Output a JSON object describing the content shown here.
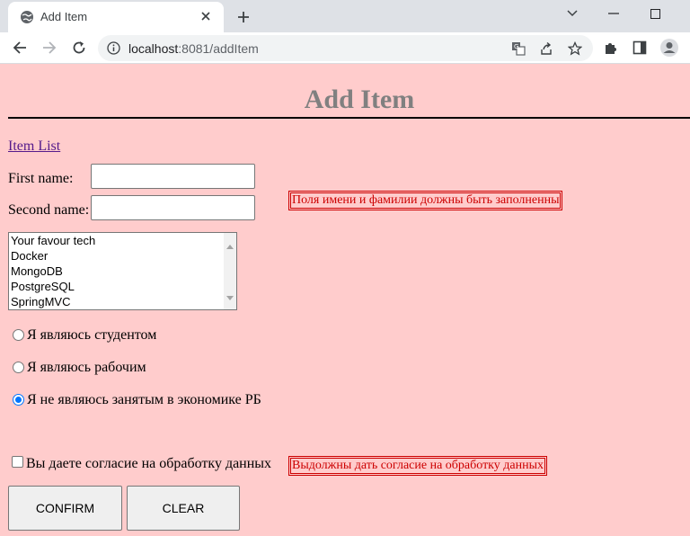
{
  "browser": {
    "tab_title": "Add Item",
    "url_host": "localhost",
    "url_path": ":8081/addItem"
  },
  "page": {
    "title": "Add Item",
    "nav_link": "Item List"
  },
  "form": {
    "first_name_label": "First name:",
    "second_name_label": "Second name:",
    "first_name_value": "",
    "second_name_value": "",
    "name_error": "Поля имени и фамилии должны быть заполненны",
    "tech_options": [
      "Your favour tech",
      "Docker",
      "MongoDB",
      "PostgreSQL",
      "SpringMVC"
    ],
    "employment": [
      {
        "label": "Я являюсь студентом",
        "checked": false
      },
      {
        "label": "Я являюсь рабочим",
        "checked": false
      },
      {
        "label": "Я не являюсь занятым в экономике РБ",
        "checked": true
      }
    ],
    "consent_label": "Вы даете согласие на обработку данных",
    "consent_checked": false,
    "consent_error": "Выдолжны дать согласие на обработку данных",
    "confirm_label": "CONFIRM",
    "clear_label": "CLEAR"
  }
}
